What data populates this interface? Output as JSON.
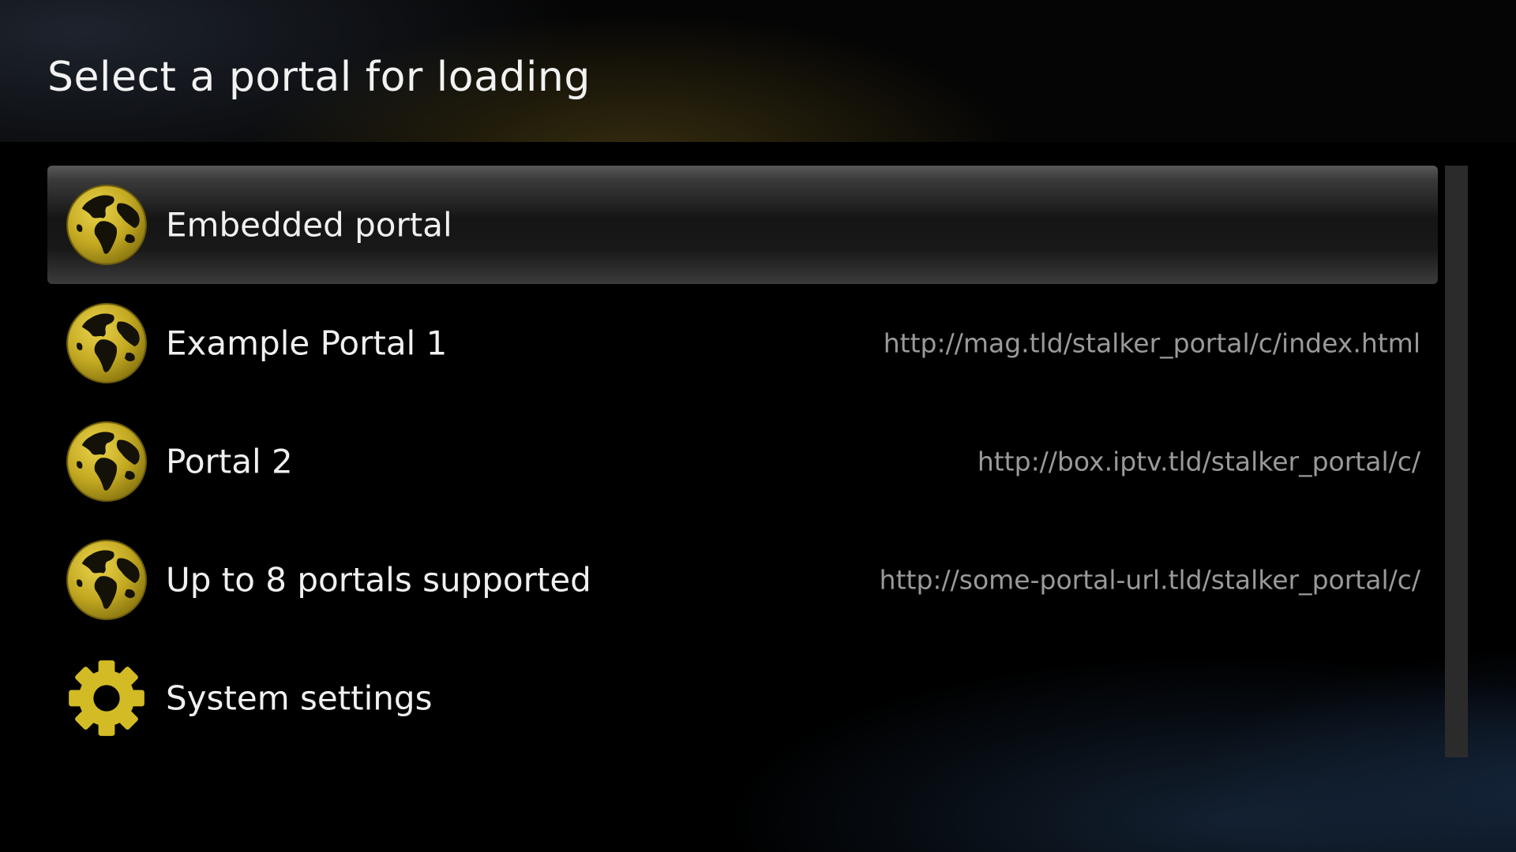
{
  "header": {
    "title": "Select a portal for loading"
  },
  "colors": {
    "accent": "#c9b227",
    "selected_row": "#2a2a2a",
    "url_text": "#9a9a9a"
  },
  "portals": [
    {
      "label": "Embedded portal",
      "url": "",
      "icon": "globe-icon",
      "selected": true
    },
    {
      "label": "Example Portal 1",
      "url": "http://mag.tld/stalker_portal/c/index.html",
      "icon": "globe-icon",
      "selected": false
    },
    {
      "label": "Portal 2",
      "url": "http://box.iptv.tld/stalker_portal/c/",
      "icon": "globe-icon",
      "selected": false
    },
    {
      "label": "Up to 8 portals supported",
      "url": "http://some-portal-url.tld/stalker_portal/c/",
      "icon": "globe-icon",
      "selected": false
    },
    {
      "label": "System settings",
      "url": "",
      "icon": "gear-icon",
      "selected": false
    }
  ]
}
